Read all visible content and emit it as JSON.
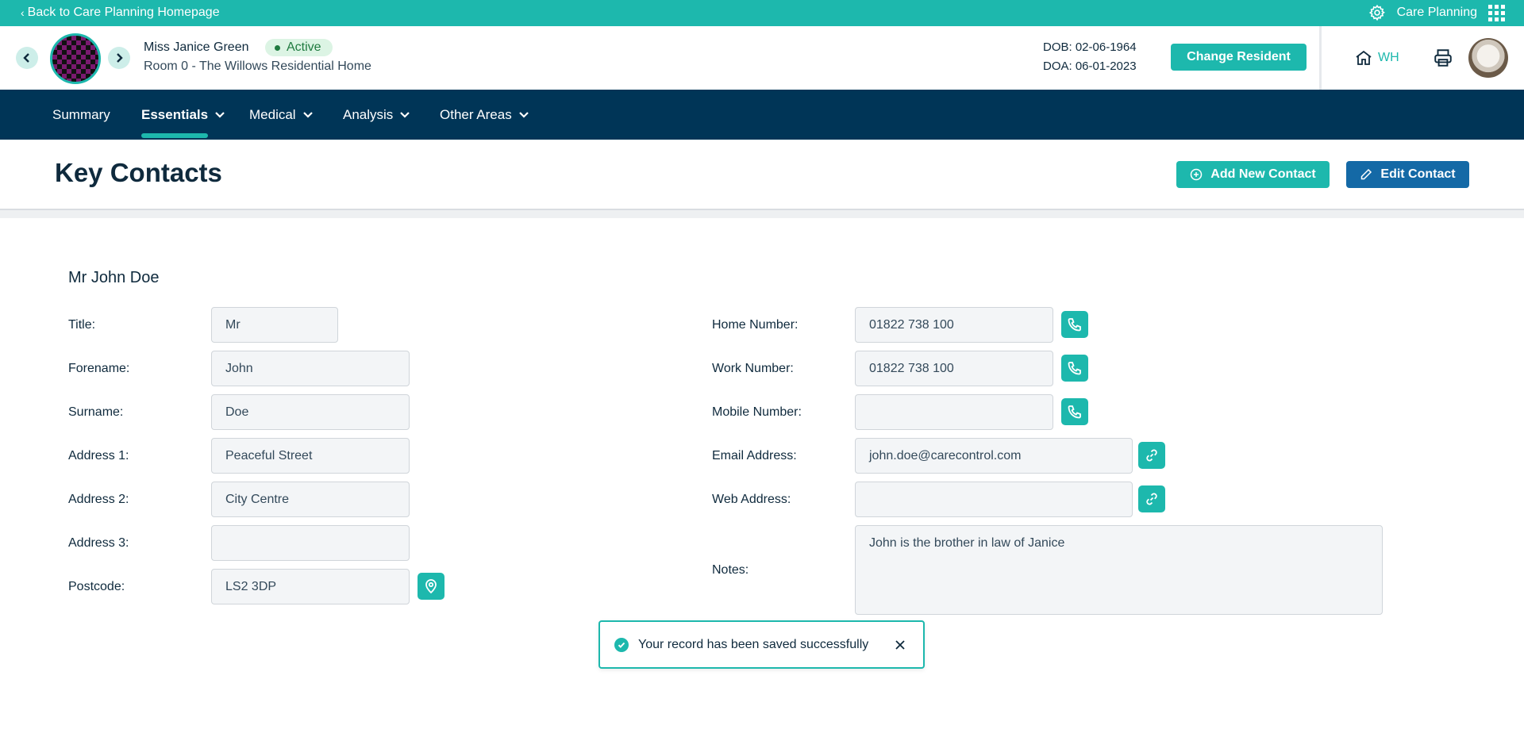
{
  "topbar": {
    "back_label": "Back to Care Planning Homepage",
    "app_name": "Care Planning",
    "icons": [
      "chevron-left-icon",
      "gear-icon",
      "apps-grid-icon"
    ]
  },
  "resident": {
    "name": "Miss Janice Green",
    "status": "Active",
    "room": "Room 0 - The Willows Residential Home",
    "dob": "DOB: 02-06-1964",
    "doa": "DOA: 06-01-2023",
    "change_label": "Change Resident",
    "home_initials": "WH"
  },
  "nav": {
    "items": [
      {
        "label": "Summary"
      },
      {
        "label": "Essentials"
      },
      {
        "label": "Medical"
      },
      {
        "label": "Analysis"
      },
      {
        "label": "Other Areas"
      }
    ],
    "active": "Essentials"
  },
  "page": {
    "title": "Key Contacts",
    "add_label": "Add New Contact",
    "edit_label": "Edit Contact"
  },
  "contact": {
    "display_name": "Mr John Doe",
    "left": [
      {
        "label": "Title:",
        "value": "Mr"
      },
      {
        "label": "Forename:",
        "value": "John"
      },
      {
        "label": "Surname:",
        "value": "Doe"
      },
      {
        "label": "Address 1:",
        "value": "Peaceful Street"
      },
      {
        "label": "Address 2:",
        "value": "City Centre"
      },
      {
        "label": "Address 3:",
        "value": ""
      },
      {
        "label": "Postcode:",
        "value": "LS2 3DP"
      }
    ],
    "right": [
      {
        "label": "Home Number:",
        "value": "01822 738 100"
      },
      {
        "label": "Work Number:",
        "value": "01822 738 100"
      },
      {
        "label": "Mobile Number:",
        "value": ""
      },
      {
        "label": "Email Address:",
        "value": "john.doe@carecontrol.com"
      },
      {
        "label": "Web Address:",
        "value": ""
      },
      {
        "label": "Notes:",
        "value": "John is the brother in law of Janice"
      }
    ]
  },
  "toast": {
    "message": "Your record has been saved successfully"
  },
  "colors": {
    "teal": "#1db8ad",
    "navy": "#003557",
    "edit_blue": "#1469a6",
    "active_green": "#1f7a3f"
  }
}
